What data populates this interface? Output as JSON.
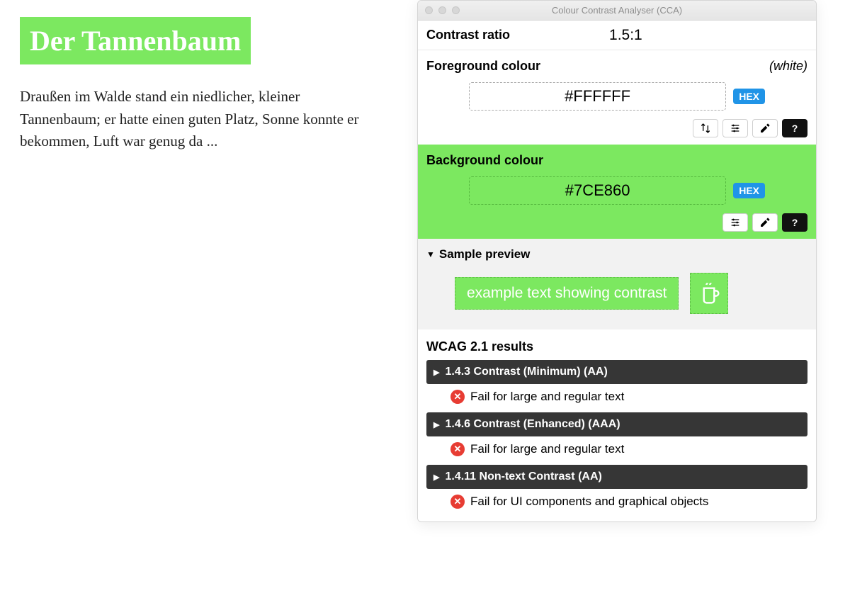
{
  "sample": {
    "heading": "Der Tannenbaum",
    "body": "Draußen im Walde stand ein niedlicher, kleiner Tannenbaum; er hatte einen guten Platz, Sonne konnte er bekommen, Luft war genug da ..."
  },
  "window": {
    "title": "Colour Contrast Analyser (CCA)"
  },
  "contrast": {
    "label": "Contrast ratio",
    "value": "1.5:1"
  },
  "foreground": {
    "label": "Foreground colour",
    "note": "(white)",
    "value": "#FFFFFF",
    "format_badge": "HEX"
  },
  "background": {
    "label": "Background colour",
    "value": "#7CE860",
    "format_badge": "HEX"
  },
  "preview": {
    "label": "Sample preview",
    "text": "example text showing contrast"
  },
  "results": {
    "title": "WCAG 2.1 results",
    "items": [
      {
        "title": "1.4.3 Contrast (Minimum) (AA)",
        "message": "Fail for large and regular text"
      },
      {
        "title": "1.4.6 Contrast (Enhanced) (AAA)",
        "message": "Fail for large and regular text"
      },
      {
        "title": "1.4.11 Non-text Contrast (AA)",
        "message": "Fail for UI components and graphical objects"
      }
    ]
  },
  "colors": {
    "accent_green": "#7CE860",
    "hex_badge_blue": "#2094e7",
    "result_header_bg": "#363636",
    "fail_red": "#e73c33"
  }
}
